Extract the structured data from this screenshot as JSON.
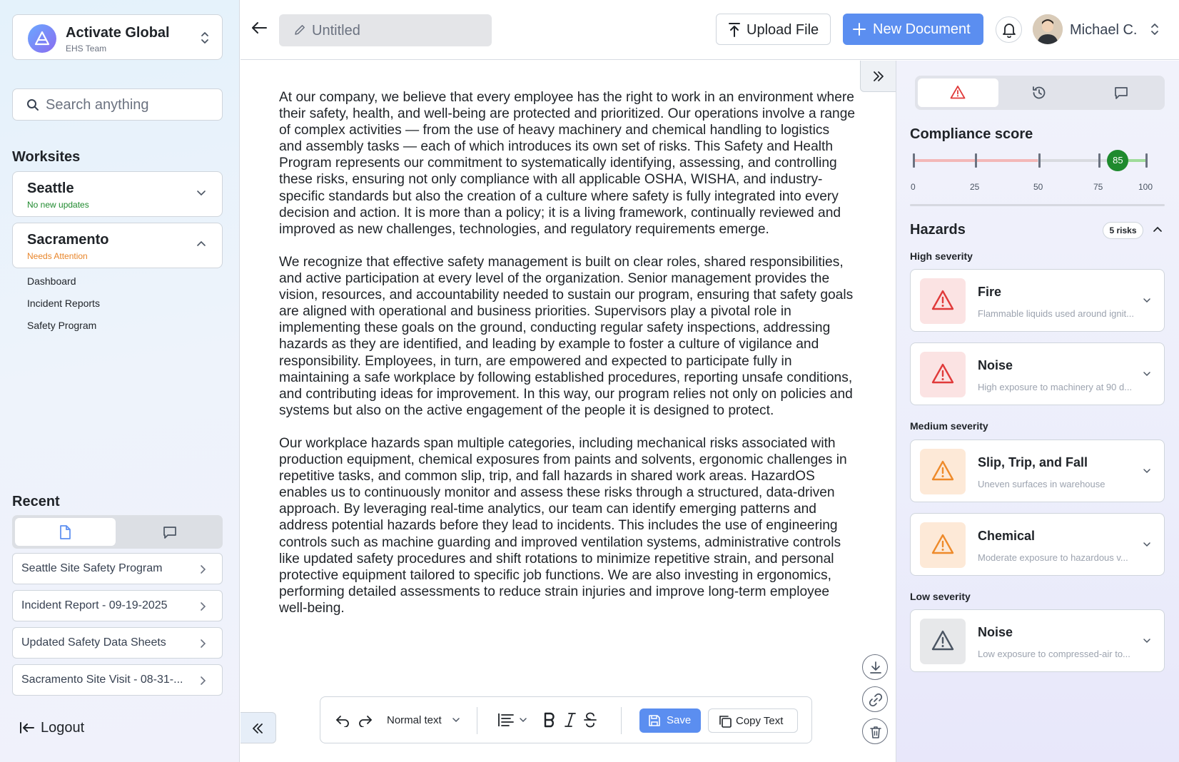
{
  "org": {
    "name": "Activate Global",
    "team": "EHS Team"
  },
  "search": {
    "placeholder": "Search anything"
  },
  "worksites": {
    "title": "Worksites",
    "items": [
      {
        "name": "Seattle",
        "status": "No new updates",
        "status_color": "#1f8a2e",
        "expanded": false
      },
      {
        "name": "Sacramento",
        "status": "Needs Attention",
        "status_color": "#e8852a",
        "expanded": true
      }
    ],
    "sub_items": [
      "Dashboard",
      "Incident Reports",
      "Safety Program"
    ]
  },
  "recent": {
    "title": "Recent",
    "tabs": [
      "document-icon",
      "chat-icon"
    ],
    "items": [
      "Seattle Site Safety Program",
      "Incident Report - 09-19-2025",
      "Updated Safety Data Sheets",
      "Sacramento Site Visit - 08-31-..."
    ]
  },
  "logout_label": "Logout",
  "topbar": {
    "title_placeholder": "Untitled",
    "upload_label": "Upload File",
    "new_doc_label": "New Document",
    "user_name": "Michael C."
  },
  "document": {
    "paragraphs": [
      "At our company, we believe that every employee has the right to work in an environment where their safety, health, and well-being are protected and prioritized. Our operations involve a range of complex activities — from the use of heavy machinery and chemical handling to logistics and assembly tasks — each of which introduces its own set of risks. This Safety and Health Program represents our commitment to systematically identifying, assessing, and controlling these risks, ensuring not only compliance with all applicable OSHA, WISHA, and industry-specific standards but also the creation of a culture where safety is fully integrated into every decision and action. It is more than a policy; it is a living framework, continually reviewed and improved as new challenges, technologies, and regulatory requirements emerge.",
      "We recognize that effective safety management is built on clear roles, shared responsibilities, and active participation at every level of the organization. Senior management provides the vision, resources, and accountability needed to sustain our program, ensuring that safety goals are aligned with operational and business priorities. Supervisors play a pivotal role in implementing these goals on the ground, conducting regular safety inspections, addressing hazards as they are identified, and leading by example to foster a culture of vigilance and responsibility. Employees, in turn, are empowered and expected to participate fully in maintaining a safe workplace by following established procedures, reporting unsafe conditions, and contributing ideas for improvement. In this way, our program relies not only on policies and systems but also on the active engagement of the people it is designed to protect.",
      "Our workplace hazards span multiple categories, including mechanical risks associated with production equipment, chemical exposures from paints and solvents, ergonomic challenges in repetitive tasks, and common slip, trip, and fall hazards in shared work areas. HazardOS enables us to continuously monitor and assess these risks through a structured, data-driven approach. By leveraging real-time analytics, our team can identify emerging patterns and address potential hazards before they lead to incidents. This includes the use of engineering controls such as machine guarding and improved ventilation systems, administrative controls like updated safety procedures and shift rotations to minimize repetitive strain, and personal protective equipment tailored to specific job functions. We are also investing in ergonomics, performing detailed assessments to reduce strain injuries and improve long-term employee well-being."
    ]
  },
  "toolbar": {
    "text_style": "Normal text",
    "save_label": "Save",
    "copy_label": "Copy Text"
  },
  "panel": {
    "tabs": [
      "warning-icon",
      "history-icon",
      "chat-icon"
    ],
    "compliance": {
      "title": "Compliance score",
      "score": 85,
      "score_label": "85",
      "ticks": [
        "0",
        "25",
        "50",
        "75",
        "100"
      ],
      "colors": {
        "low": "#f3b8b8",
        "mid": "#d9dbe0",
        "high": "#9fdc9a",
        "knob": "#1f8a2e"
      }
    },
    "hazards": {
      "title": "Hazards",
      "count_label": "5 risks",
      "groups": [
        {
          "label": "High severity",
          "color": "#e03a3a",
          "bg": "#fbe3e3",
          "items": [
            {
              "name": "Fire",
              "desc": "Flammable liquids used around ignit..."
            },
            {
              "name": "Noise",
              "desc": "High exposure to machinery at 90 d..."
            }
          ]
        },
        {
          "label": "Medium severity",
          "color": "#ee8a2a",
          "bg": "#fde9d7",
          "items": [
            {
              "name": "Slip, Trip, and Fall",
              "desc": "Uneven surfaces in warehouse"
            },
            {
              "name": "Chemical",
              "desc": "Moderate exposure to hazardous v..."
            }
          ]
        },
        {
          "label": "Low severity",
          "color": "#4b5563",
          "bg": "#e7e8ea",
          "items": [
            {
              "name": "Noise",
              "desc": "Low exposure to compressed-air to..."
            }
          ]
        }
      ]
    }
  }
}
